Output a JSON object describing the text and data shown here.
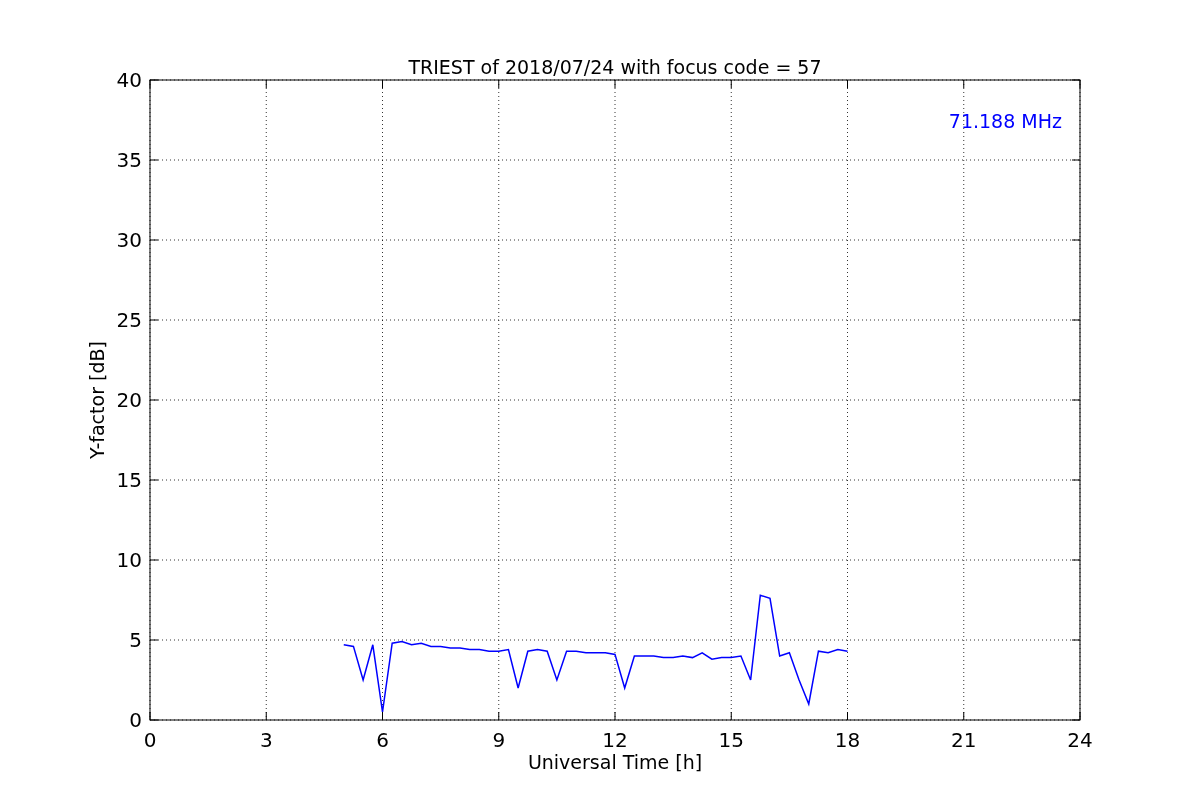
{
  "figure": {
    "chart_data": {
      "type": "line",
      "title": "TRIEST of 2018/07/24 with focus code = 57",
      "xlabel": "Universal Time [h]",
      "ylabel": "Y-factor [dB]",
      "xlim": [
        0,
        24
      ],
      "ylim": [
        0,
        40
      ],
      "xticks": [
        0,
        3,
        6,
        9,
        12,
        15,
        18,
        21,
        24
      ],
      "yticks": [
        0,
        5,
        10,
        15,
        20,
        25,
        30,
        35,
        40
      ],
      "x": [
        5.0,
        5.25,
        5.5,
        5.75,
        6.0,
        6.25,
        6.5,
        6.75,
        7.0,
        7.25,
        7.5,
        7.75,
        8.0,
        8.25,
        8.5,
        8.75,
        9.0,
        9.25,
        9.5,
        9.75,
        10.0,
        10.25,
        10.5,
        10.75,
        11.0,
        11.25,
        11.5,
        11.75,
        12.0,
        12.25,
        12.5,
        12.75,
        13.0,
        13.25,
        13.5,
        13.75,
        14.0,
        14.25,
        14.5,
        14.75,
        15.0,
        15.25,
        15.5,
        15.75,
        16.0,
        16.25,
        16.5,
        16.75,
        17.0,
        17.25,
        17.5,
        17.75,
        18.0
      ],
      "series": [
        {
          "name": "71.188 MHz",
          "color": "#0000ff",
          "values": [
            4.7,
            4.6,
            2.5,
            4.7,
            0.5,
            4.8,
            4.9,
            4.7,
            4.8,
            4.6,
            4.6,
            4.5,
            4.5,
            4.4,
            4.4,
            4.3,
            4.3,
            4.4,
            2.0,
            4.3,
            4.4,
            4.3,
            2.5,
            4.3,
            4.3,
            4.2,
            4.2,
            4.2,
            4.1,
            2.0,
            4.0,
            4.0,
            4.0,
            3.9,
            3.9,
            4.0,
            3.9,
            4.2,
            3.8,
            3.9,
            3.9,
            4.0,
            2.5,
            7.8,
            7.6,
            4.0,
            4.2,
            2.5,
            1.0,
            4.3,
            4.2,
            4.4,
            4.3
          ]
        }
      ],
      "grid": true
    }
  }
}
